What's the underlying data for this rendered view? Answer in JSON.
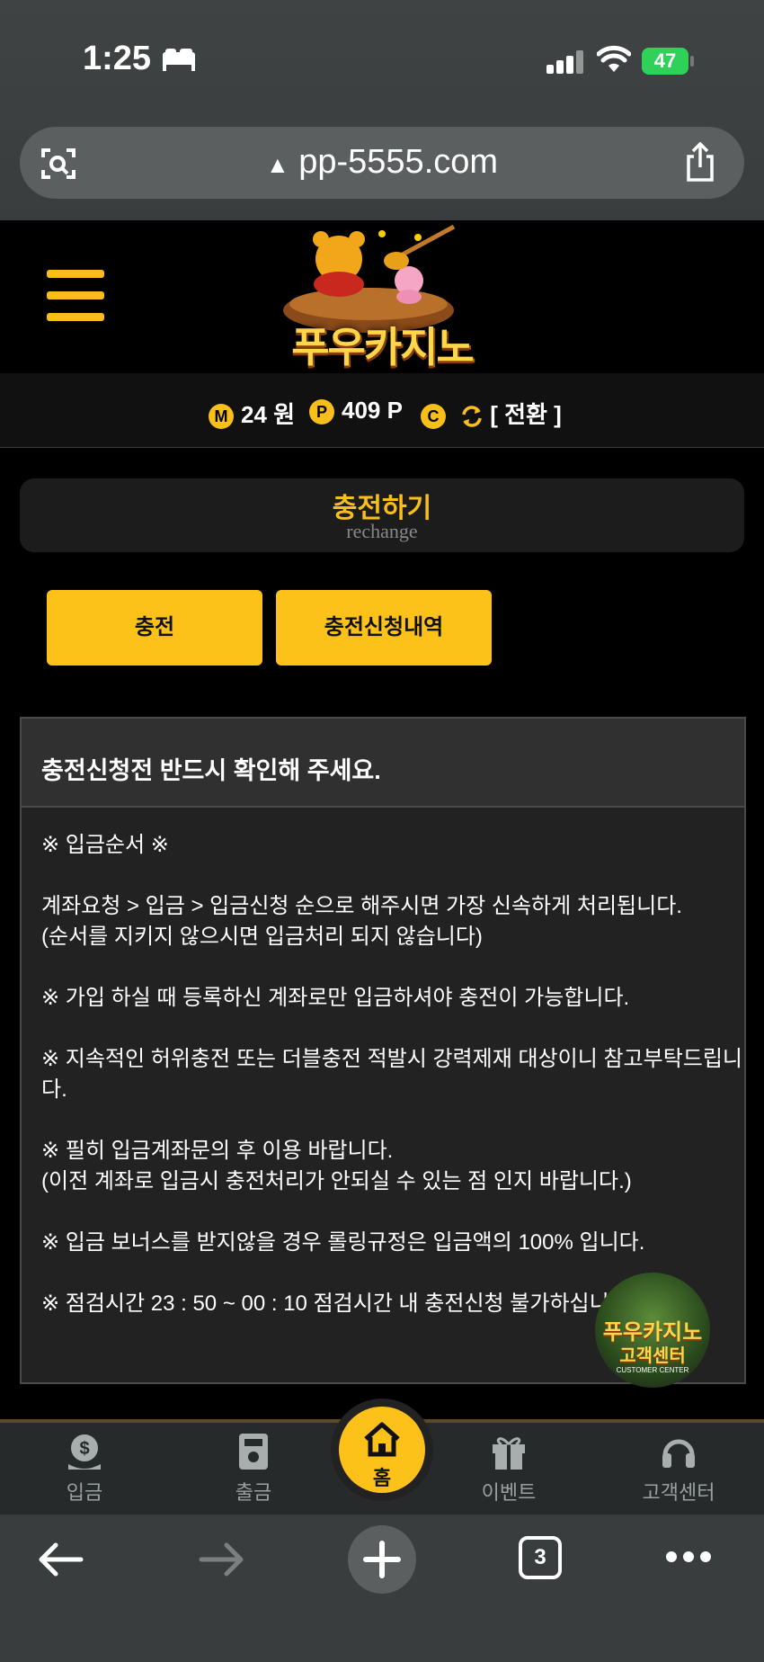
{
  "status_bar": {
    "time": "1:25",
    "battery": "47"
  },
  "browser": {
    "url": "pp-5555.com"
  },
  "header": {
    "logo_text": "푸우카지노"
  },
  "balance": {
    "money_icon": "M",
    "money": "24 원",
    "point_icon": "P",
    "points": "409 P",
    "comp_icon": "C",
    "convert_label": "[ 전환 ]"
  },
  "page_title": {
    "main": "충전하기",
    "sub": "rechange"
  },
  "buttons": {
    "deposit": "충전",
    "history": "충전신청내역"
  },
  "notice": {
    "title": "충전신청전 반드시 확인해 주세요.",
    "lines": [
      "※ 입금순서 ※",
      "계좌요청 > 입금 > 입금신청 순으로 해주시면 가장 신속하게 처리됩니다.",
      "(순서를 지키지 않으시면 입금처리 되지 않습니다)",
      "※ 가입 하실 때 등록하신 계좌로만 입금하셔야 충전이 가능합니다.",
      "※ 지속적인 허위충전 또는 더블충전 적발시 강력제재 대상이니 참고부탁드립니다.",
      "※ 필히 입금계좌문의 후 이용 바랍니다.",
      "(이전 계좌로 입금시 충전처리가 안되실 수 있는 점 인지 바랍니다.)",
      "※ 입금 보너스를 받지않을 경우 롤링규정은 입금액의 100% 입니다.",
      "※ 점검시간 23 : 50 ~ 00 : 10 점검시간 내 충전신청 불가하십니다."
    ]
  },
  "cs_badge": {
    "line1": "푸우카지노",
    "line2": "고객센터",
    "line3": "CUSTOMER CENTER"
  },
  "bottom_nav": {
    "deposit": "입금",
    "withdraw": "출금",
    "home": "홈",
    "event": "이벤트",
    "support": "고객센터"
  },
  "safari": {
    "tabs_count": "3"
  },
  "colors": {
    "accent": "#fdc219",
    "background": "#000000",
    "panel": "#222222"
  }
}
